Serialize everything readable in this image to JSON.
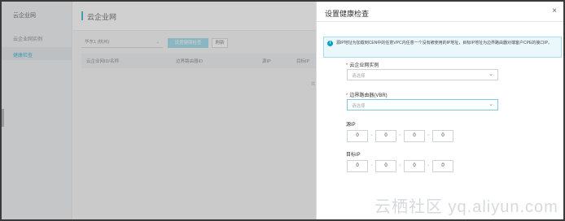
{
  "sidebar": {
    "title": "云企业网",
    "items": [
      {
        "label": "云企业网实例"
      },
      {
        "label": "健康检查"
      }
    ]
  },
  "main": {
    "title": "云企业网",
    "region": "华东1 (杭州)",
    "action_button": "设置健康检查",
    "refresh_button": "刷新",
    "columns": [
      "云企业网ID/名称",
      "边界路由器ID",
      "源IP",
      "目标IP"
    ],
    "pager": "共"
  },
  "panel": {
    "title": "设置健康检查",
    "close": "×",
    "notice": "源IP地址为加载到CEN中的任意VPC内任意一个没有被使用的IP地址，目标IP地址为边界路由器对端客户CPE的接口IP。",
    "fields": {
      "cen_label": "云企业网实例",
      "cen_placeholder": "请选择",
      "vbr_label": "边界路由器(VBR)",
      "vbr_placeholder": "请选择",
      "src_label": "源IP",
      "dst_label": "目标IP"
    },
    "src_ip": [
      "0",
      "0",
      "0",
      "0"
    ],
    "dst_ip": [
      "0",
      "0",
      "0",
      "0"
    ]
  },
  "watermark": "云栖社区 yq.aliyun.com"
}
